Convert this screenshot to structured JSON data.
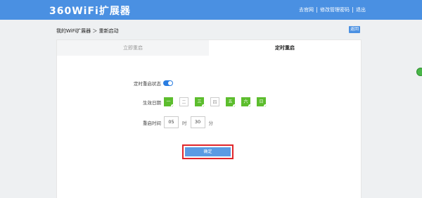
{
  "header": {
    "logo": "360WiFi扩展器",
    "links": [
      "去官网",
      "修改管理密码",
      "退出"
    ]
  },
  "breadcrumb": "我的WiFi扩展器 ＞ 重新启动",
  "back_label": "返回",
  "tabs": [
    {
      "label": "立即重启",
      "active": false
    },
    {
      "label": "定时重启",
      "active": true
    }
  ],
  "form": {
    "status_label": "定时重启状态",
    "status_on": true,
    "days_label": "生效日期",
    "days": [
      {
        "label": "一",
        "selected": true
      },
      {
        "label": "二",
        "selected": false
      },
      {
        "label": "三",
        "selected": true
      },
      {
        "label": "四",
        "selected": false
      },
      {
        "label": "五",
        "selected": true
      },
      {
        "label": "六",
        "selected": true
      },
      {
        "label": "日",
        "selected": true
      }
    ],
    "time_label": "重启时间",
    "hour": "05",
    "hour_unit": "时",
    "minute": "30",
    "minute_unit": "分"
  },
  "confirm_label": "确定",
  "colors": {
    "topbar": "#4a90e2",
    "day_selected": "#5cbd2d",
    "highlight": "#e0262b"
  }
}
